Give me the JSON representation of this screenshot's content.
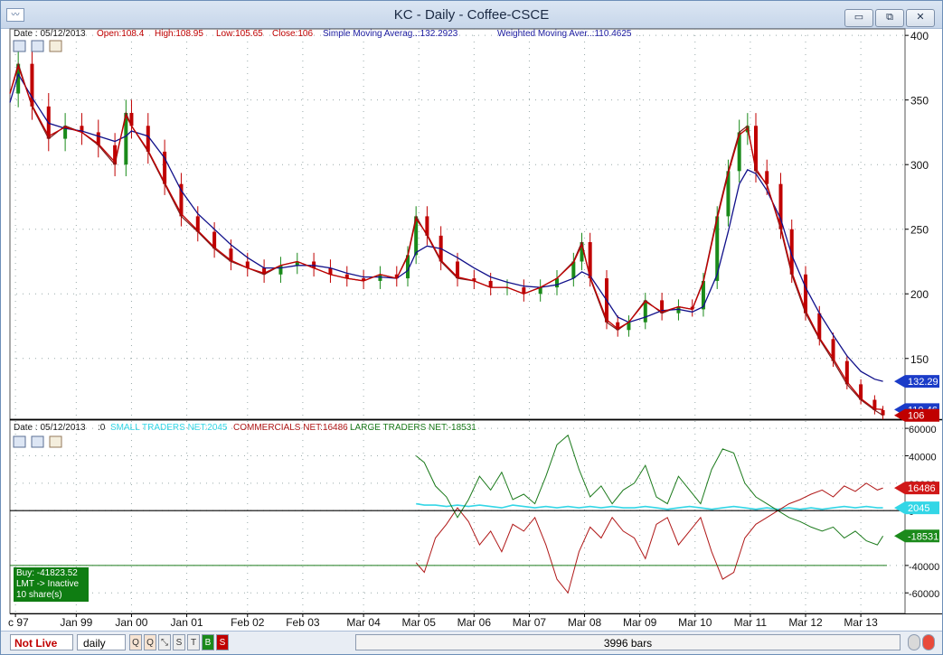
{
  "window": {
    "title": "KC  -  Daily - Coffee-CSCE",
    "icon_name": "chart-app-icon",
    "minimize_label": "▭",
    "maximize_label": "⧉",
    "close_label": "✕"
  },
  "price_panel": {
    "legend": {
      "date": "Date : 05/12/2013",
      "open": "Open:108.4",
      "high": "High:108.95",
      "low": "Low:105.65",
      "close": "Close:106",
      "sma": "Simple Moving Averag..:132.2923",
      "wma": "Weighted Moving Aver..:110.4625"
    },
    "markers": {
      "sma": "132.29",
      "wma": "110.46",
      "close": "106"
    },
    "colors": {
      "legend_black": "#1b1b1b",
      "legend_red": "#c00000",
      "legend_blue": "#1a1aa0",
      "sma": "#10108a",
      "wma": "#c00000",
      "candle_up": "#1a8a1a",
      "candle_down": "#c00000"
    }
  },
  "cot_panel": {
    "legend": {
      "date": "Date : 05/12/2013",
      "zero": ":0",
      "small": "SMALL TRADERS NET:2045",
      "commercials": "COMMERCIALS NET:16486",
      "large": "LARGE TRADERS NET:-18531"
    },
    "markers": {
      "commercials": "16486",
      "small": "2045",
      "large": "-18531"
    },
    "colors": {
      "small": "#33d6e6",
      "commercials": "#b01818",
      "large": "#1b7a1b"
    }
  },
  "order_box": {
    "line1": "Buy:  -41823.52",
    "line2": "LMT  ->  Inactive",
    "line3": "10 share(s)"
  },
  "status_bar": {
    "live_label": "Not Live",
    "interval": "daily",
    "tool_buttons": [
      "Q",
      "Q",
      "⤡",
      "S",
      "T",
      "B",
      "S"
    ],
    "bars_label": "3996 bars"
  },
  "chart_data": [
    {
      "type": "line",
      "title": "KC  -  Daily - Coffee-CSCE",
      "x_axis": {
        "ticks": [
          "c 97",
          "Jan 99",
          "Jan 00",
          "Jan 01",
          "Feb 02",
          "Feb 03",
          "Mar 04",
          "Mar 05",
          "Mar 06",
          "Mar 07",
          "Mar 08",
          "Mar 09",
          "Mar 10",
          "Mar 11",
          "Mar 12",
          "Mar 13"
        ],
        "tick_positions": [
          1997.9,
          1999.0,
          2000.0,
          2001.0,
          2002.1,
          2003.1,
          2004.2,
          2005.2,
          2006.2,
          2007.2,
          2008.2,
          2009.2,
          2010.2,
          2011.2,
          2012.2,
          2013.2
        ],
        "range": [
          1997.8,
          2014.0
        ]
      },
      "y_axis": {
        "range": [
          103,
          405
        ],
        "ticks": [
          150,
          200,
          250,
          300,
          350,
          400
        ]
      },
      "grid": true,
      "x": [
        1997.8,
        1997.95,
        1998.2,
        1998.5,
        1998.8,
        1999.1,
        1999.4,
        1999.7,
        1999.9,
        2000.0,
        2000.3,
        2000.6,
        2000.9,
        2001.2,
        2001.5,
        2001.8,
        2002.1,
        2002.4,
        2002.7,
        2003.0,
        2003.3,
        2003.6,
        2003.9,
        2004.2,
        2004.5,
        2004.8,
        2005.0,
        2005.15,
        2005.35,
        2005.6,
        2005.9,
        2006.2,
        2006.5,
        2006.8,
        2007.1,
        2007.4,
        2007.7,
        2008.0,
        2008.15,
        2008.3,
        2008.6,
        2008.8,
        2009.0,
        2009.3,
        2009.6,
        2009.9,
        2010.15,
        2010.35,
        2010.6,
        2010.8,
        2011.0,
        2011.15,
        2011.3,
        2011.5,
        2011.75,
        2011.95,
        2012.2,
        2012.45,
        2012.7,
        2012.95,
        2013.2,
        2013.45,
        2013.6
      ],
      "series": [
        {
          "name": "Close",
          "values": [
            355,
            378,
            345,
            320,
            330,
            325,
            315,
            300,
            340,
            330,
            310,
            285,
            260,
            248,
            235,
            225,
            220,
            215,
            222,
            225,
            220,
            215,
            212,
            210,
            215,
            212,
            230,
            260,
            245,
            225,
            212,
            210,
            205,
            205,
            200,
            205,
            212,
            225,
            240,
            212,
            178,
            172,
            178,
            195,
            185,
            190,
            188,
            210,
            260,
            295,
            325,
            330,
            295,
            285,
            250,
            215,
            185,
            165,
            148,
            130,
            118,
            110,
            106
          ]
        },
        {
          "name": "Simple Moving Averag..",
          "values": [
            348,
            370,
            352,
            332,
            328,
            326,
            322,
            318,
            322,
            326,
            322,
            305,
            280,
            262,
            250,
            238,
            228,
            220,
            220,
            222,
            222,
            220,
            216,
            213,
            213,
            212,
            218,
            232,
            237,
            235,
            228,
            220,
            213,
            209,
            206,
            205,
            207,
            212,
            217,
            214,
            195,
            182,
            178,
            182,
            187,
            188,
            186,
            190,
            215,
            248,
            285,
            296,
            293,
            280,
            258,
            230,
            205,
            185,
            168,
            152,
            140,
            134,
            132.29
          ]
        },
        {
          "name": "Weighted Moving Aver..",
          "values": [
            355,
            376,
            346,
            322,
            329,
            325,
            316,
            302,
            338,
            330,
            311,
            286,
            262,
            249,
            236,
            226,
            220,
            216,
            222,
            225,
            220,
            215,
            212,
            210,
            215,
            212,
            229,
            258,
            246,
            226,
            213,
            210,
            205,
            205,
            200,
            205,
            212,
            224,
            238,
            213,
            180,
            173,
            178,
            194,
            186,
            190,
            188,
            209,
            258,
            293,
            323,
            328,
            297,
            284,
            252,
            217,
            187,
            166,
            150,
            132,
            119,
            111,
            110.46
          ]
        }
      ]
    },
    {
      "type": "line",
      "x_axis": {
        "range": [
          1997.8,
          2014.0
        ]
      },
      "y_axis": {
        "range": [
          -75000,
          66000
        ],
        "ticks": [
          60000,
          40000,
          20000,
          0,
          -40000,
          -60000
        ]
      },
      "grid": true,
      "x": [
        2005.15,
        2005.3,
        2005.5,
        2005.7,
        2005.9,
        2006.1,
        2006.3,
        2006.5,
        2006.7,
        2006.9,
        2007.1,
        2007.3,
        2007.5,
        2007.7,
        2007.9,
        2008.1,
        2008.3,
        2008.5,
        2008.7,
        2008.9,
        2009.1,
        2009.3,
        2009.5,
        2009.7,
        2009.9,
        2010.1,
        2010.3,
        2010.5,
        2010.7,
        2010.9,
        2011.1,
        2011.3,
        2011.5,
        2011.7,
        2011.9,
        2012.1,
        2012.3,
        2012.5,
        2012.7,
        2012.9,
        2013.1,
        2013.3,
        2013.5,
        2013.6
      ],
      "series": [
        {
          "name": "SMALL TRADERS NET",
          "values": [
            5000,
            4000,
            4000,
            3000,
            4000,
            3000,
            4000,
            3000,
            2000,
            4000,
            3000,
            2000,
            3000,
            2000,
            3000,
            2000,
            3000,
            2000,
            3000,
            2000,
            2000,
            3000,
            2000,
            1000,
            2000,
            3000,
            2000,
            1000,
            2000,
            3000,
            2000,
            1000,
            2000,
            1000,
            2000,
            1000,
            2000,
            1000,
            2000,
            3000,
            2000,
            3000,
            2000,
            2045
          ]
        },
        {
          "name": "COMMERCIALS NET",
          "values": [
            -38000,
            -45000,
            -20000,
            -10000,
            2000,
            -8000,
            -25000,
            -15000,
            -30000,
            -10000,
            -15000,
            -5000,
            -25000,
            -50000,
            -60000,
            -30000,
            -12000,
            -20000,
            -5000,
            -15000,
            -20000,
            -35000,
            -10000,
            -5000,
            -25000,
            -15000,
            -5000,
            -30000,
            -50000,
            -45000,
            -20000,
            -10000,
            -5000,
            0,
            5000,
            8000,
            12000,
            15000,
            10000,
            18000,
            14000,
            20000,
            15000,
            16486
          ]
        },
        {
          "name": "LARGE TRADERS NET",
          "values": [
            40000,
            35000,
            18000,
            10000,
            -5000,
            8000,
            25000,
            15000,
            28000,
            8000,
            12000,
            5000,
            25000,
            48000,
            55000,
            30000,
            10000,
            18000,
            5000,
            15000,
            20000,
            33000,
            10000,
            5000,
            25000,
            15000,
            5000,
            30000,
            45000,
            42000,
            20000,
            10000,
            5000,
            0,
            -5000,
            -8000,
            -12000,
            -15000,
            -12000,
            -20000,
            -15000,
            -22000,
            -25000,
            -18531
          ]
        }
      ]
    }
  ]
}
